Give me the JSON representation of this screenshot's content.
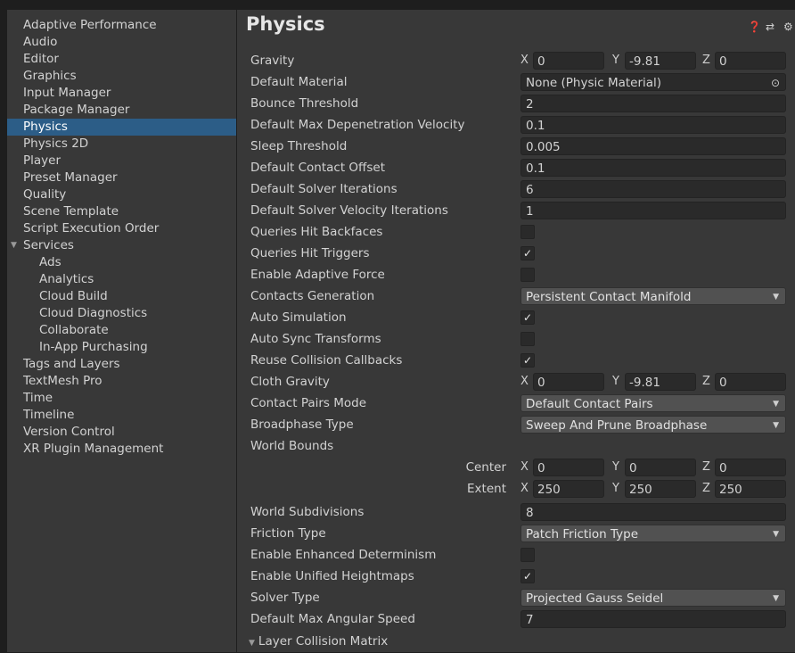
{
  "sidebar": {
    "items": [
      {
        "label": "Adaptive Performance"
      },
      {
        "label": "Audio"
      },
      {
        "label": "Editor"
      },
      {
        "label": "Graphics"
      },
      {
        "label": "Input Manager"
      },
      {
        "label": "Package Manager"
      },
      {
        "label": "Physics",
        "selected": true
      },
      {
        "label": "Physics 2D"
      },
      {
        "label": "Player"
      },
      {
        "label": "Preset Manager"
      },
      {
        "label": "Quality"
      },
      {
        "label": "Scene Template"
      },
      {
        "label": "Script Execution Order"
      },
      {
        "label": "Services",
        "expanded": true
      },
      {
        "label": "Ads"
      },
      {
        "label": "Analytics"
      },
      {
        "label": "Cloud Build"
      },
      {
        "label": "Cloud Diagnostics"
      },
      {
        "label": "Collaborate"
      },
      {
        "label": "In-App Purchasing"
      },
      {
        "label": "Tags and Layers"
      },
      {
        "label": "TextMesh Pro"
      },
      {
        "label": "Time"
      },
      {
        "label": "Timeline"
      },
      {
        "label": "Version Control"
      },
      {
        "label": "XR Plugin Management"
      }
    ]
  },
  "header": {
    "title": "Physics",
    "icons": [
      "help-icon",
      "preset-icon",
      "settings-gear-icon"
    ]
  },
  "settings": {
    "gravity": {
      "label": "Gravity",
      "x": "0",
      "y": "-9.81",
      "z": "0"
    },
    "default_material": {
      "label": "Default Material",
      "value": "None (Physic Material)"
    },
    "bounce_threshold": {
      "label": "Bounce Threshold",
      "value": "2"
    },
    "max_depenetration": {
      "label": "Default Max Depenetration Velocity",
      "value": "0.1"
    },
    "sleep_threshold": {
      "label": "Sleep Threshold",
      "value": "0.005"
    },
    "contact_offset": {
      "label": "Default Contact Offset",
      "value": "0.1"
    },
    "solver_iterations": {
      "label": "Default Solver Iterations",
      "value": "6"
    },
    "solver_velocity_iterations": {
      "label": "Default Solver Velocity Iterations",
      "value": "1"
    },
    "queries_hit_backfaces": {
      "label": "Queries Hit Backfaces",
      "checked": false
    },
    "queries_hit_triggers": {
      "label": "Queries Hit Triggers",
      "checked": true
    },
    "enable_adaptive_force": {
      "label": "Enable Adaptive Force",
      "checked": false
    },
    "contacts_generation": {
      "label": "Contacts Generation",
      "value": "Persistent Contact Manifold"
    },
    "auto_simulation": {
      "label": "Auto Simulation",
      "checked": true
    },
    "auto_sync_transforms": {
      "label": "Auto Sync Transforms",
      "checked": false
    },
    "reuse_collision_callbacks": {
      "label": "Reuse Collision Callbacks",
      "checked": true
    },
    "cloth_gravity": {
      "label": "Cloth Gravity",
      "x": "0",
      "y": "-9.81",
      "z": "0"
    },
    "contact_pairs_mode": {
      "label": "Contact Pairs Mode",
      "value": "Default Contact Pairs"
    },
    "broadphase_type": {
      "label": "Broadphase Type",
      "value": "Sweep And Prune Broadphase"
    },
    "world_bounds": {
      "label": "World Bounds",
      "center": {
        "label": "Center",
        "x": "0",
        "y": "0",
        "z": "0"
      },
      "extent": {
        "label": "Extent",
        "x": "250",
        "y": "250",
        "z": "250"
      }
    },
    "world_subdivisions": {
      "label": "World Subdivisions",
      "value": "8"
    },
    "friction_type": {
      "label": "Friction Type",
      "value": "Patch Friction Type"
    },
    "enhanced_determinism": {
      "label": "Enable Enhanced Determinism",
      "checked": false
    },
    "unified_heightmaps": {
      "label": "Enable Unified Heightmaps",
      "checked": true
    },
    "solver_type": {
      "label": "Solver Type",
      "value": "Projected Gauss Seidel"
    },
    "max_angular_speed": {
      "label": "Default Max Angular Speed",
      "value": "7"
    },
    "layer_collision_matrix": {
      "label": "Layer Collision Matrix",
      "expanded": true
    }
  },
  "axis_labels": {
    "x": "X",
    "y": "Y",
    "z": "Z"
  },
  "glyphs": {
    "check": "✓",
    "caret": "▼",
    "tri_down": "▼",
    "help": "❓",
    "preset": "⇄",
    "gear": "⚙",
    "object_picker": "⊙"
  },
  "colors": {
    "selection": "#2c5d87",
    "panel": "#383838",
    "field": "#2a2a2a",
    "dropdown": "#515151"
  }
}
